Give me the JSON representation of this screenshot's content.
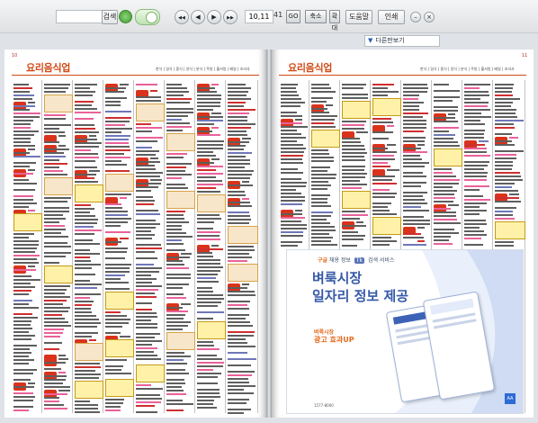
{
  "toolbar": {
    "search_label": "검색",
    "page_number": "10,11",
    "page_total": "41",
    "go_label": "GO",
    "zoom_out_label": "축소",
    "zoom_in_label": "확대",
    "bookmark_label": "도움말",
    "print_label": "인쇄",
    "nav_first": "◀◀",
    "nav_prev": "◀",
    "nav_next": "▶",
    "nav_last": "▶▶"
  },
  "dropdown": {
    "label": "다른판보기"
  },
  "left_page": {
    "page_no": "10",
    "title": "요리음식업",
    "subhead": "한식 | 일식 | 중식 | 양식 | 분식 | 주방 | 홀서빙 | 배달 | 조리사"
  },
  "right_page": {
    "page_no": "11",
    "title": "요리음식업",
    "subhead": "한식 | 일식 | 중식 | 양식 | 분식 | 주방 | 홀서빙 | 배달 | 조리사"
  },
  "ad": {
    "tag_left": "구글",
    "tag_mid": "채용 정보",
    "tag_chip": "Tk",
    "tag_right": "검색 서비스",
    "headline1": "벼룩시장",
    "headline2": "일자리 정보 제공",
    "note1": "벼룩시장",
    "note2": "광고 효과UP",
    "phone": "1577-8000",
    "logo": "AA"
  },
  "colors": {
    "accent": "#d24a16",
    "ad_blue": "#3659a8",
    "toggle_green": "#3e9a2d"
  }
}
